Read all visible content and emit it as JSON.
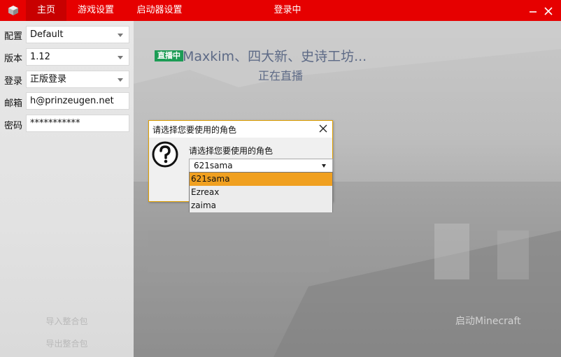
{
  "titlebar": {
    "tabs": [
      {
        "label": "主页",
        "active": true
      },
      {
        "label": "游戏设置",
        "active": false
      },
      {
        "label": "启动器设置",
        "active": false
      }
    ],
    "title": "登录中",
    "accent_color": "#e60000"
  },
  "sidebar": {
    "fields": [
      {
        "label": "配置",
        "value": "Default",
        "type": "select"
      },
      {
        "label": "版本",
        "value": "1.12",
        "type": "select"
      },
      {
        "label": "登录",
        "value": "正版登录",
        "type": "select"
      },
      {
        "label": "邮箱",
        "value": "h@prinzeugen.net",
        "type": "text"
      },
      {
        "label": "密码",
        "value": "***********",
        "type": "password"
      }
    ],
    "import_pack": "导入整合包",
    "export_pack": "导出整合包"
  },
  "main": {
    "live_badge": "直播中",
    "live_title": "Maxkim、四大新、史诗工坊...",
    "live_status": "正在直播",
    "launch_button": "启动Minecraft"
  },
  "dialog": {
    "title": "请选择您要使用的角色",
    "prompt": "请选择您要使用的角色",
    "selected": "621sama",
    "options": [
      "621sama",
      "Ezreax",
      "zaima"
    ],
    "highlight_color": "#f0a020",
    "border_color": "#e0a000"
  }
}
